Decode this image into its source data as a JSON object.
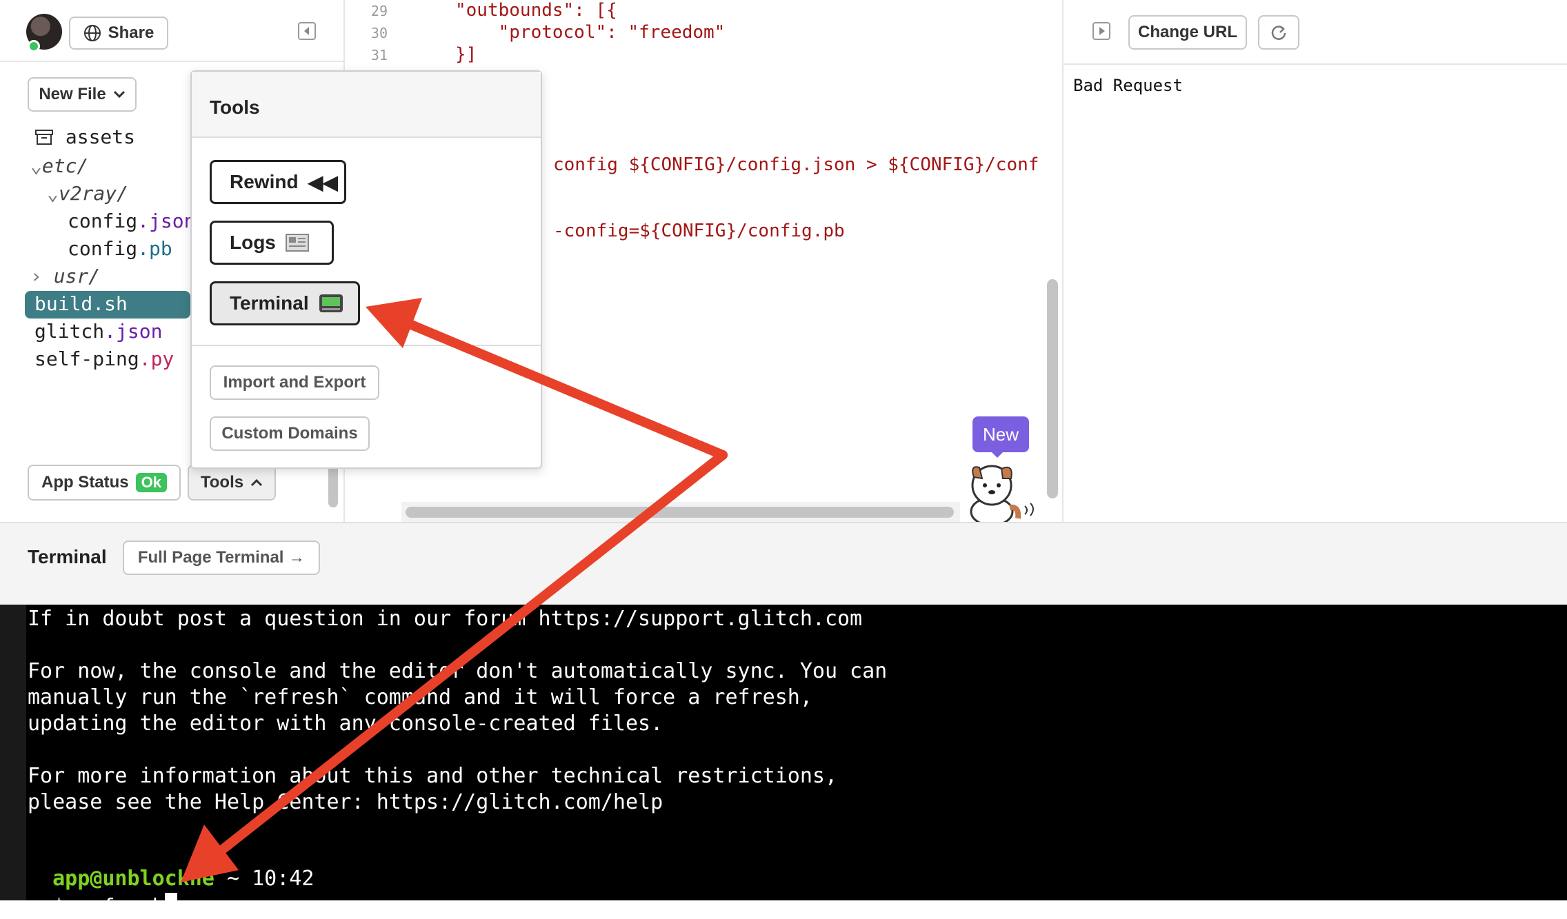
{
  "sidebar": {
    "share_label": "Share",
    "new_file_label": "New File",
    "files": [
      {
        "name": "assets",
        "ext": ""
      },
      {
        "name": "etc/",
        "ext": ""
      },
      {
        "name": "v2ray/",
        "ext": ""
      },
      {
        "name": "config",
        "ext": ".json"
      },
      {
        "name": "config",
        "ext": ".pb"
      },
      {
        "name": "usr/",
        "ext": ""
      },
      {
        "name": "build.sh",
        "ext": ""
      },
      {
        "name": "glitch",
        "ext": ".json"
      },
      {
        "name": "self-ping",
        "ext": ".py"
      }
    ],
    "app_status_label": "App Status",
    "app_status_badge": "Ok",
    "tools_label": "Tools"
  },
  "editor": {
    "lines": [
      {
        "num": "29",
        "text": "\"outbounds\": [{"
      },
      {
        "num": "30",
        "text": "    \"protocol\": \"freedom\""
      },
      {
        "num": "31",
        "text": "}]"
      }
    ],
    "code_fragment_1": "config ${CONFIG}/config.json > ${CONFIG}/conf",
    "code_fragment_2": "-config=${CONFIG}/config.pb",
    "new_badge": "New"
  },
  "tools_popup": {
    "title": "Tools",
    "rewind": "Rewind",
    "logs": "Logs",
    "terminal": "Terminal",
    "import_export": "Import and Export",
    "custom_domains": "Custom Domains"
  },
  "preview": {
    "change_url_label": "Change URL",
    "content": "Bad Request"
  },
  "terminal": {
    "title": "Terminal",
    "full_page_label": "Full Page Terminal →",
    "lines": [
      "If in doubt post a question in our forum https://support.glitch.com",
      "",
      "For now, the console and the editor don't automatically sync. You can",
      "manually run the `refresh` command and it will force a refresh,",
      "updating the editor with any console-created files.",
      "",
      "For more information about this and other technical restrictions,",
      "please see the Help Center: https://glitch.com/help",
      ""
    ],
    "prompt_user": "app@unblockne",
    "prompt_time": "~ 10:42",
    "command": "$ refresh"
  },
  "colors": {
    "selected_file_bg": "#3e7d86",
    "annotation_arrow": "#e8412a",
    "badge_purple": "#7b5fe0",
    "status_ok": "#3cc35d"
  }
}
